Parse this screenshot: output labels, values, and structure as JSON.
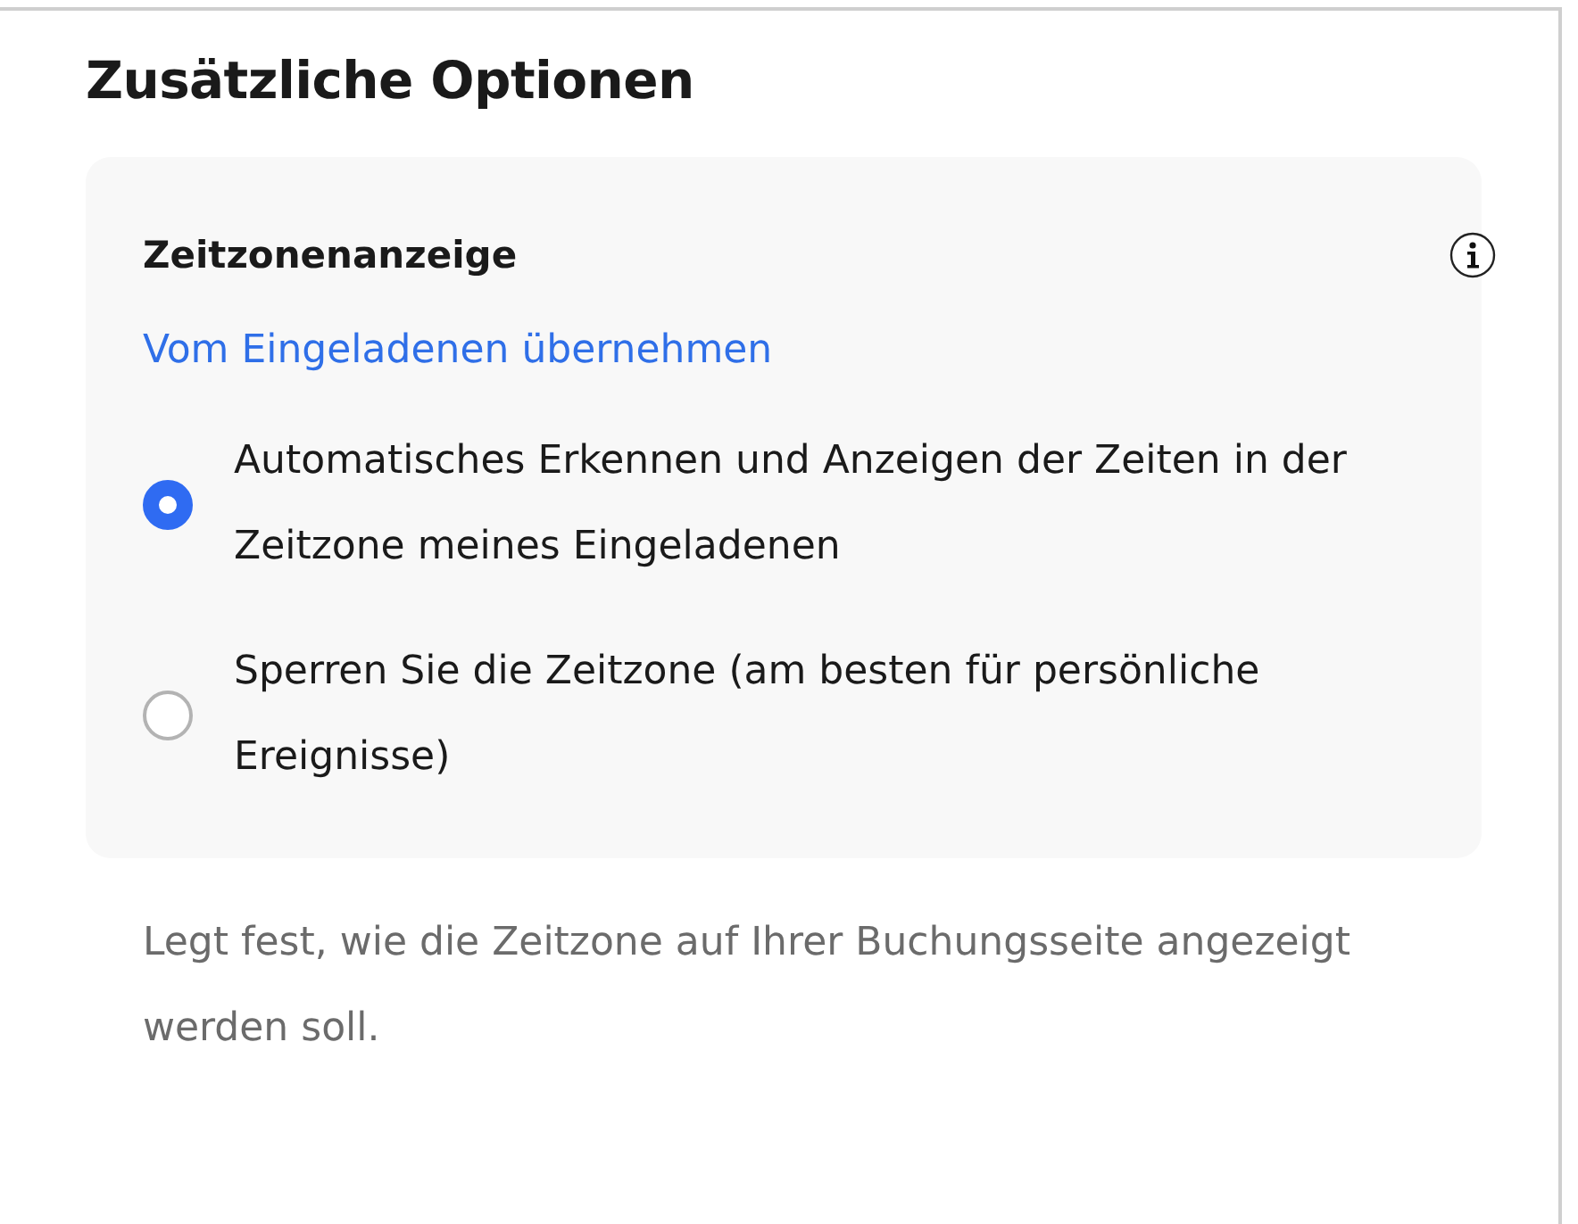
{
  "section_title": "Zusätzliche Optionen",
  "card": {
    "title": "Zeitzonenanzeige",
    "link": "Vom Eingeladenen übernehmen",
    "options": [
      {
        "label": "Automatisches Erkennen und Anzeigen der Zeiten in der Zeitzone meines Eingeladenen",
        "selected": true
      },
      {
        "label": "Sperren Sie die Zeitzone (am besten für persönliche Ereignisse)",
        "selected": false
      }
    ]
  },
  "help_text": "Legt fest, wie die Zeitzone auf Ihrer Buchungsseite angezeigt werden soll."
}
